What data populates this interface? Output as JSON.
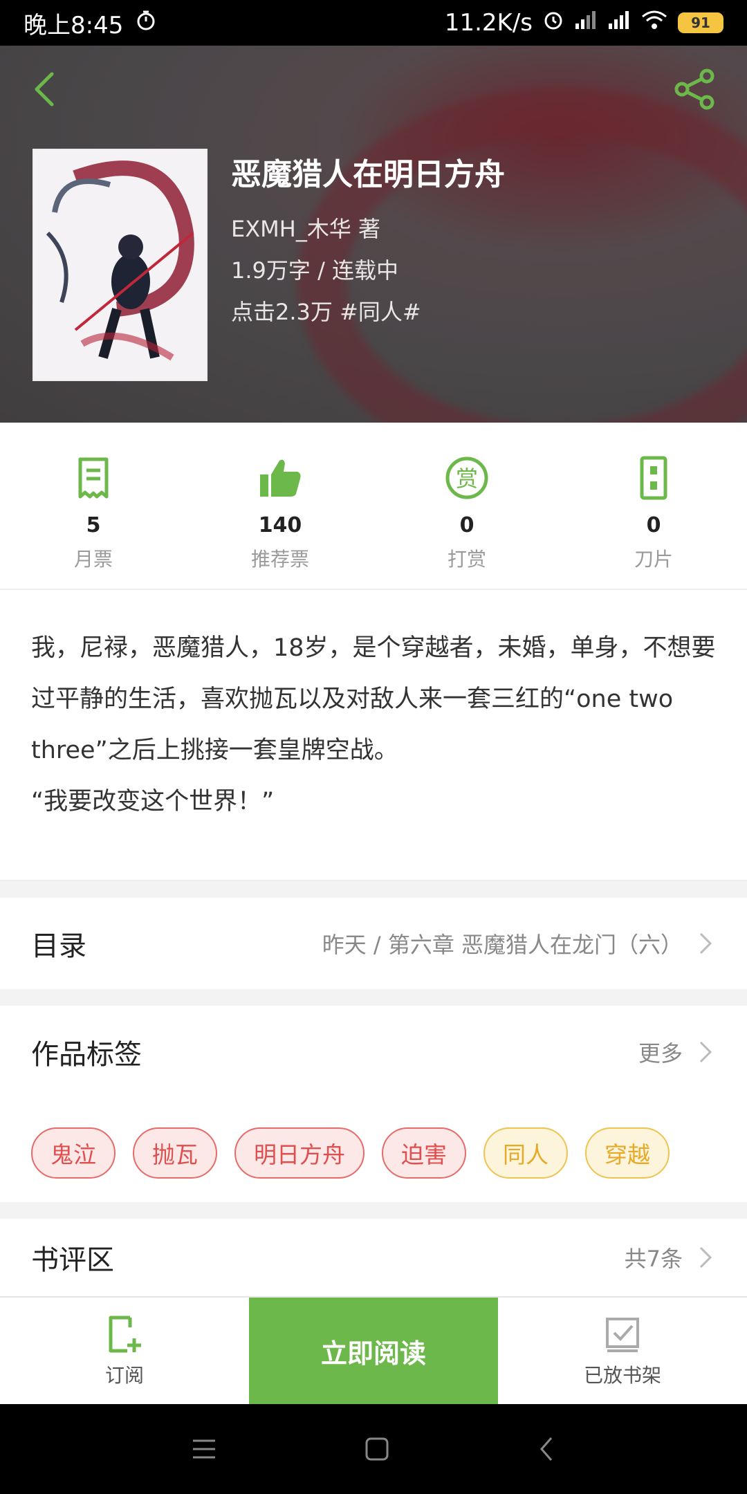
{
  "status_bar": {
    "time": "晚上8:45",
    "speed": "11.2K/s",
    "battery": "91"
  },
  "book": {
    "title": "恶魔猎人在明日方舟",
    "author": "EXMH_木华  著",
    "words_status": "1.9万字 / 连载中",
    "clicks_tags": "点击2.3万  #同人#"
  },
  "stats": [
    {
      "value": "5",
      "label": "月票",
      "icon": "monthly-ticket-icon"
    },
    {
      "value": "140",
      "label": "推荐票",
      "icon": "thumbs-up-icon"
    },
    {
      "value": "0",
      "label": "打赏",
      "icon": "reward-icon"
    },
    {
      "value": "0",
      "label": "刀片",
      "icon": "blade-icon"
    }
  ],
  "description": {
    "text": "我，尼禄，恶魔猎人，18岁，是个穿越者，未婚，单身，不想要过平静的生活，喜欢抛瓦以及对敌人来一套三红的“one two three”之后上挑接一套皇牌空战。",
    "quote": "“我要改变这个世界！”"
  },
  "toc": {
    "title": "目录",
    "latest": "昨天 / 第六章 恶魔猎人在龙门（六）"
  },
  "tags_section": {
    "title": "作品标签",
    "more": "更多",
    "tags": [
      "鬼泣",
      "抛瓦",
      "明日方舟",
      "迫害",
      "同人",
      "穿越"
    ]
  },
  "reviews": {
    "title": "书评区",
    "count": "共7条"
  },
  "bottom_bar": {
    "subscribe": "订阅",
    "read_now": "立即阅读",
    "on_shelf": "已放书架"
  },
  "colors": {
    "accent": "#6db84a",
    "tag_red": "#e04f4f",
    "tag_yellow": "#e8a928"
  }
}
